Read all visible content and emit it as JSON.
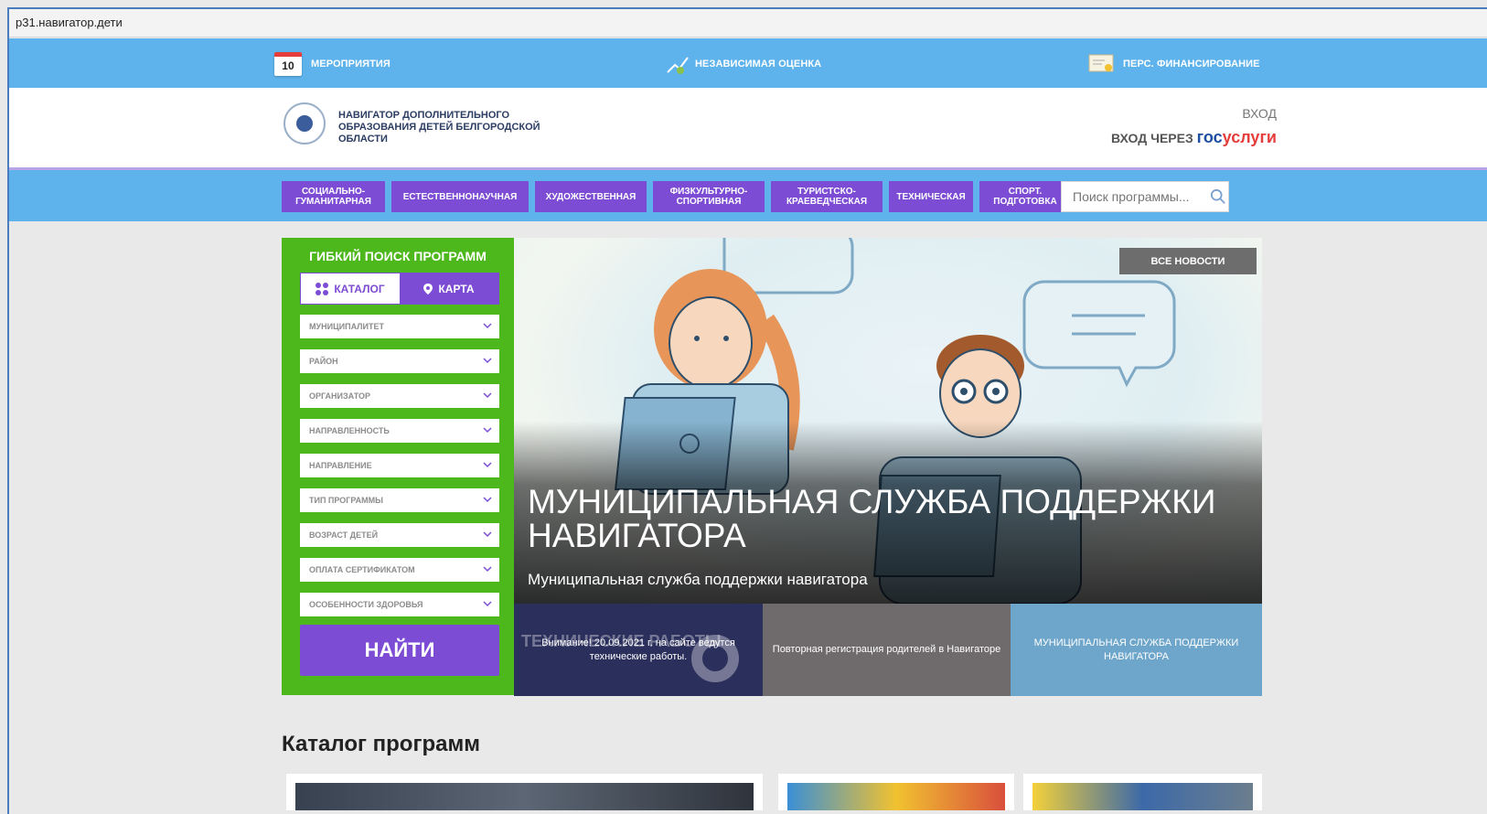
{
  "browser": {
    "url": "p31.навигатор.дети"
  },
  "topbar": {
    "events": {
      "day": "10",
      "label": "МЕРОПРИЯТИЯ"
    },
    "rating": {
      "label": "НЕЗАВИСИМАЯ ОЦЕНКА"
    },
    "funding": {
      "label": "ПЕРС. ФИНАНСИРОВАНИЕ"
    }
  },
  "header": {
    "logo_text": "НАВИГАТОР ДОПОЛНИТЕЛЬНОГО ОБРАЗОВАНИЯ ДЕТЕЙ БЕЛГОРОДСКОЙ ОБЛАСТИ",
    "login": "ВХОД",
    "login_via": "ВХОД ЧЕРЕЗ",
    "gos_a": "гос",
    "gos_b": "услуги"
  },
  "nav": {
    "categories": [
      "СОЦИАЛЬНО-ГУМАНИТАРНАЯ",
      "ЕСТЕСТВЕННОНАУЧНАЯ",
      "ХУДОЖЕСТВЕННАЯ",
      "ФИЗКУЛЬТУРНО-СПОРТИВНАЯ",
      "ТУРИСТСКО-КРАЕВЕДЧЕСКАЯ",
      "ТЕХНИЧЕСКАЯ",
      "СПОРТ. ПОДГОТОВКА"
    ],
    "search_placeholder": "Поиск программы..."
  },
  "sidebar": {
    "title": "ГИБКИЙ ПОИСК ПРОГРАММ",
    "tab_catalog": "КАТАЛОГ",
    "tab_map": "КАРТА",
    "filters": [
      "МУНИЦИПАЛИТЕТ",
      "РАЙОН",
      "ОРГАНИЗАТОР",
      "НАПРАВЛЕННОСТЬ",
      "НАПРАВЛЕНИЕ",
      "ТИП ПРОГРАММЫ",
      "ВОЗРАСТ ДЕТЕЙ",
      "ОПЛАТА СЕРТИФИКАТОМ",
      "ОСОБЕННОСТИ ЗДОРОВЬЯ"
    ],
    "find_button": "НАЙТИ"
  },
  "hero": {
    "all_news": "ВСЕ НОВОСТИ",
    "title": "МУНИЦИПАЛЬНАЯ СЛУЖБА ПОДДЕРЖКИ НАВИГАТОРА",
    "subtitle": "Муниципальная служба поддержки навигатора"
  },
  "news_tiles": [
    {
      "caption": "Внимание! 20.09.2021 г. на сайте ведутся технические работы.",
      "bg_text": "ТЕХНИЧЕСКИЕ РАБОТЫ"
    },
    {
      "caption": "Повторная регистрация родителей в Навигаторе"
    },
    {
      "caption": "МУНИЦИПАЛЬНАЯ СЛУЖБА ПОДДЕРЖКИ НАВИГАТОРА"
    }
  ],
  "catalog": {
    "title": "Каталог программ"
  },
  "colors": {
    "top_blue": "#5fb3ec",
    "purple": "#7d4cd4",
    "green": "#4db81c",
    "gos_blue": "#1f4fa3",
    "gos_red": "#e53c3c"
  }
}
